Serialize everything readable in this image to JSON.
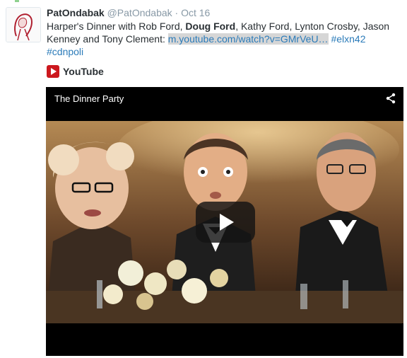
{
  "tweet": {
    "author_name": "PatOndabak",
    "author_handle": "@PatOndabak",
    "separator": "·",
    "date": "Oct 16",
    "text_part1": "Harper's Dinner with Rob Ford, ",
    "text_bold": "Doug Ford",
    "text_part2": ", Kathy Ford, Lynton Crosby, Jason Kenney and Tony Clement: ",
    "link_url": "m.youtube.com/watch?v=GMrVeU…",
    "hashtag1": "#elxn42",
    "hashtag2": "#cdnpoli"
  },
  "card": {
    "source": "YouTube",
    "icon": "youtube-icon",
    "video_title": "The Dinner Party",
    "share_icon": "share-icon",
    "play_icon": "play-icon"
  },
  "colors": {
    "link": "#2b7bb9",
    "youtube_red": "#cc181e"
  }
}
